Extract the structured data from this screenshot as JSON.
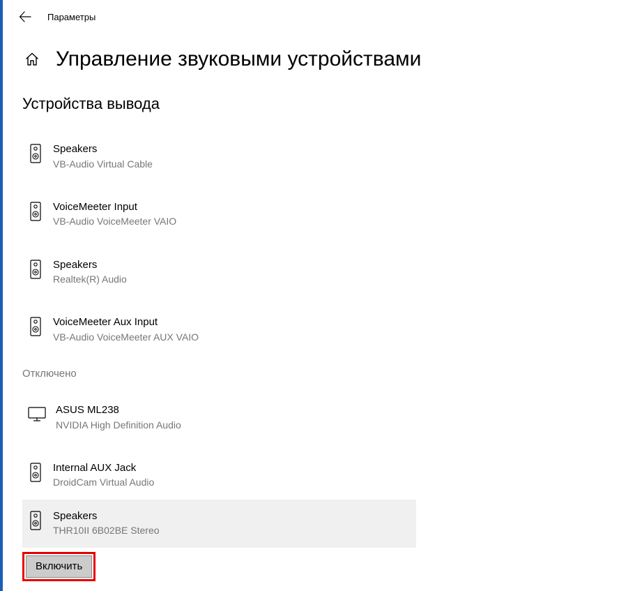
{
  "header": {
    "title": "Параметры"
  },
  "page": {
    "title": "Управление звуковыми устройствами"
  },
  "sections": {
    "output_heading": "Устройства вывода",
    "disabled_label": "Отключено"
  },
  "devices": {
    "output": [
      {
        "name": "Speakers",
        "sub": "VB-Audio Virtual Cable",
        "icon": "speaker"
      },
      {
        "name": "VoiceMeeter Input",
        "sub": "VB-Audio VoiceMeeter VAIO",
        "icon": "speaker"
      },
      {
        "name": "Speakers",
        "sub": "Realtek(R) Audio",
        "icon": "speaker"
      },
      {
        "name": "VoiceMeeter Aux Input",
        "sub": "VB-Audio VoiceMeeter AUX VAIO",
        "icon": "speaker"
      }
    ],
    "disabled": [
      {
        "name": "ASUS ML238",
        "sub": "NVIDIA High Definition Audio",
        "icon": "monitor"
      },
      {
        "name": "Internal AUX Jack",
        "sub": "DroidCam Virtual Audio",
        "icon": "speaker"
      },
      {
        "name": "Speakers",
        "sub": "THR10II 6B02BE Stereo",
        "icon": "speaker",
        "selected": true
      }
    ]
  },
  "buttons": {
    "enable": "Включить"
  }
}
